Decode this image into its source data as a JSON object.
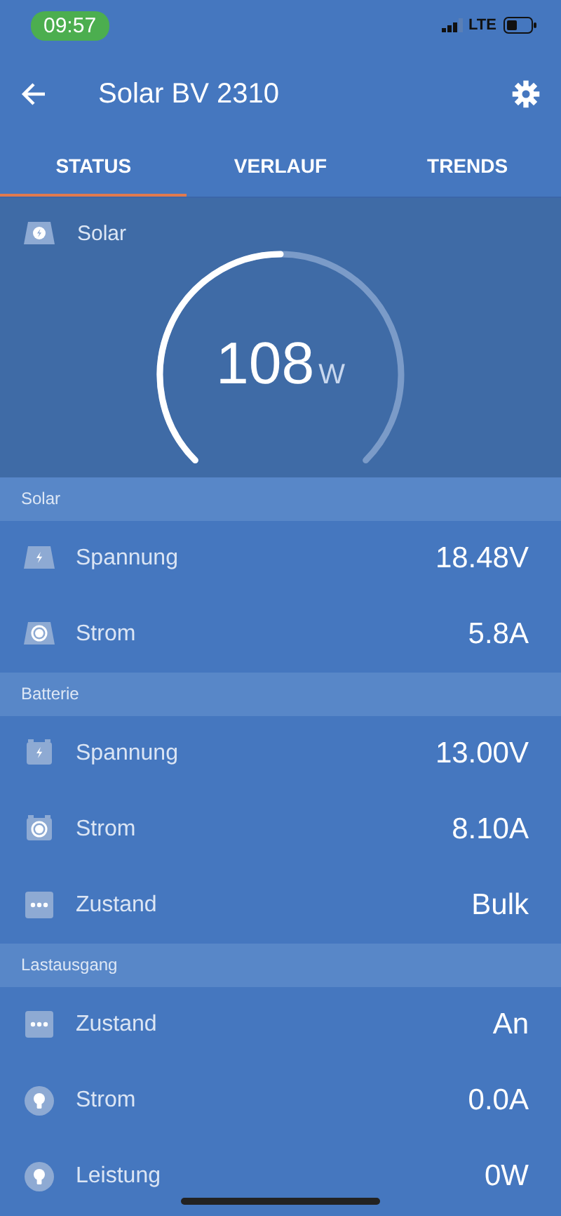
{
  "status_bar": {
    "time": "09:57",
    "network": "LTE"
  },
  "app_bar": {
    "title": "Solar BV 2310"
  },
  "tabs": [
    {
      "label": "STATUS",
      "selected": true
    },
    {
      "label": "VERLAUF",
      "selected": false
    },
    {
      "label": "TRENDS",
      "selected": false
    }
  ],
  "gauge": {
    "label": "Solar",
    "value": "108",
    "unit": "W"
  },
  "sections": [
    {
      "title": "Solar",
      "rows": [
        {
          "kind": "panel-voltage",
          "label": "Spannung",
          "value": "18.48V"
        },
        {
          "kind": "panel-current",
          "label": "Strom",
          "value": "5.8A"
        }
      ]
    },
    {
      "title": "Batterie",
      "rows": [
        {
          "kind": "battery-voltage",
          "label": "Spannung",
          "value": "13.00V"
        },
        {
          "kind": "battery-current",
          "label": "Strom",
          "value": "8.10A"
        },
        {
          "kind": "state",
          "label": "Zustand",
          "value": "Bulk"
        }
      ]
    },
    {
      "title": "Lastausgang",
      "rows": [
        {
          "kind": "state",
          "label": "Zustand",
          "value": "An"
        },
        {
          "kind": "load",
          "label": "Strom",
          "value": "0.0A"
        },
        {
          "kind": "load",
          "label": "Leistung",
          "value": "0W"
        }
      ]
    }
  ]
}
